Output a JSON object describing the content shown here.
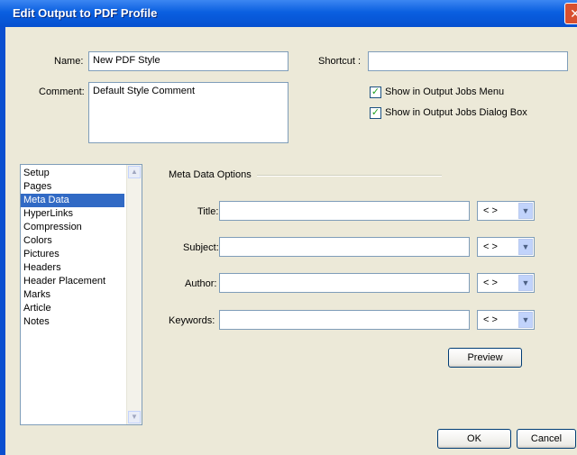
{
  "window": {
    "title": "Edit Output to PDF Profile",
    "close_glyph": "✕"
  },
  "form": {
    "name_label": "Name:",
    "name_value": "New PDF Style",
    "comment_label": "Comment:",
    "comment_value": "Default Style Comment",
    "shortcut_label": "Shortcut :",
    "shortcut_value": "",
    "show_jobs_menu_label": "Show in Output Jobs Menu",
    "show_jobs_menu_checked": true,
    "show_jobs_dialog_label": "Show in Output Jobs Dialog Box",
    "show_jobs_dialog_checked": true
  },
  "sidebar": {
    "items": [
      {
        "label": "Setup"
      },
      {
        "label": "Pages"
      },
      {
        "label": "Meta Data",
        "selected": true
      },
      {
        "label": "HyperLinks"
      },
      {
        "label": "Compression"
      },
      {
        "label": "Colors"
      },
      {
        "label": "Pictures"
      },
      {
        "label": "Headers"
      },
      {
        "label": "Header Placement"
      },
      {
        "label": "Marks"
      },
      {
        "label": "Article"
      },
      {
        "label": "Notes"
      }
    ]
  },
  "meta": {
    "group_title": "Meta Data Options",
    "fields": [
      {
        "label": "Title:",
        "value": "",
        "combo": "< >"
      },
      {
        "label": "Subject:",
        "value": "",
        "combo": "< >"
      },
      {
        "label": "Author:",
        "value": "",
        "combo": "< >"
      },
      {
        "label": "Keywords:",
        "value": "",
        "combo": "< >"
      }
    ],
    "preview_label": "Preview"
  },
  "buttons": {
    "ok_label": "OK",
    "cancel_label": "Cancel"
  },
  "colors": {
    "titlebar": "#0a5fe0",
    "dialog_bg": "#ece9d8",
    "selection": "#316ac5"
  }
}
